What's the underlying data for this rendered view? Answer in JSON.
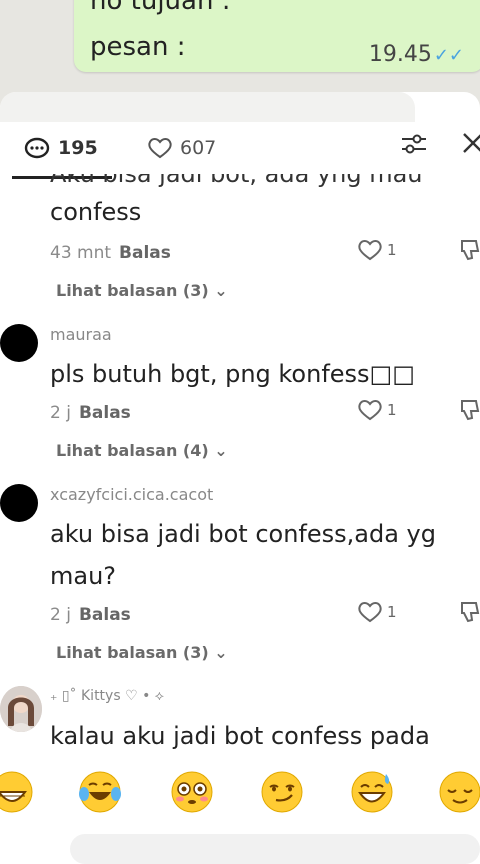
{
  "chat_bubble": {
    "line1": "no tujuan :",
    "line2": "pesan :",
    "time": "19.45"
  },
  "header": {
    "comments_count": "195",
    "likes_count": "607"
  },
  "comments": [
    {
      "text_cut": "Aku bisa jadi bot, ada yng mau",
      "text": "confess",
      "time": "43 mnt",
      "reply": "Balas",
      "likes": "1",
      "view_replies": "Lihat balasan (3)"
    },
    {
      "username": "mauraa",
      "text": "pls butuh bgt, png konfess□□",
      "time": "2 j",
      "reply": "Balas",
      "likes": "1",
      "view_replies": "Lihat balasan (4)"
    },
    {
      "username": "xcazyfcici.cica.cacot",
      "text_line1": "aku bisa jadi bot confess,ada yg",
      "text_line2": "mau?",
      "time": "2 j",
      "reply": "Balas",
      "likes": "1",
      "view_replies": "Lihat balasan (3)"
    },
    {
      "username": "₊ ▯˚  Kittys ♡ •  ⟡",
      "text": "kalau aku jadi bot confess pada"
    }
  ],
  "emojis": [
    "grinning",
    "joy",
    "flushed",
    "smirk",
    "sweat-smile",
    "relieved"
  ]
}
